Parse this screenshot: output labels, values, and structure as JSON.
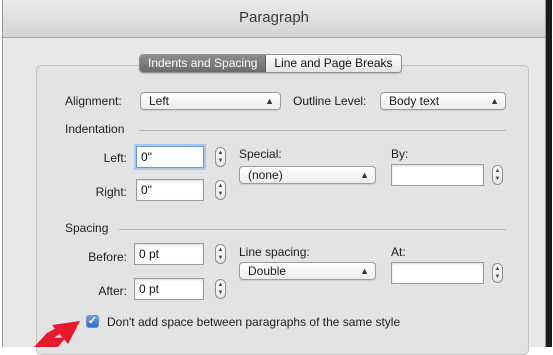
{
  "window": {
    "title": "Paragraph"
  },
  "tabs": [
    {
      "label": "Indents and Spacing",
      "active": true
    },
    {
      "label": "Line and Page Breaks",
      "active": false
    }
  ],
  "general": {
    "alignment_label": "Alignment:",
    "alignment_value": "Left",
    "outline_label": "Outline Level:",
    "outline_value": "Body text"
  },
  "indentation": {
    "section_label": "Indentation",
    "left_label": "Left:",
    "left_value": "0\"",
    "right_label": "Right:",
    "right_value": "0\"",
    "special_label": "Special:",
    "special_value": "(none)",
    "by_label": "By:",
    "by_value": ""
  },
  "spacing": {
    "section_label": "Spacing",
    "before_label": "Before:",
    "before_value": "0 pt",
    "after_label": "After:",
    "after_value": "0 pt",
    "line_spacing_label": "Line spacing:",
    "line_spacing_value": "Double",
    "at_label": "At:",
    "at_value": ""
  },
  "options": {
    "dont_add_space_label": "Don't add space between paragraphs of the same style",
    "dont_add_space_checked": true
  },
  "icons": {
    "popup_arrows": "⌃⌄",
    "stepper_arrows": "⌃⌄",
    "checkmark": "✓"
  },
  "colors": {
    "accent": "#2d6fc4",
    "annotation_arrow": "#e8192c"
  }
}
